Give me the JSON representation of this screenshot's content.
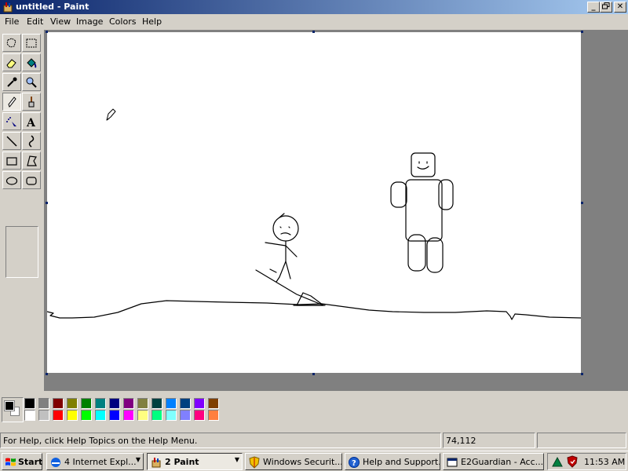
{
  "window": {
    "title": "untitled - Paint"
  },
  "menu": {
    "items": [
      "File",
      "Edit",
      "View",
      "Image",
      "Colors",
      "Help"
    ]
  },
  "tools": [
    "free-select",
    "rect-select",
    "eraser",
    "fill",
    "color-picker",
    "magnifier",
    "pencil",
    "brush",
    "airbrush",
    "text",
    "line",
    "curve",
    "rectangle",
    "polygon",
    "ellipse",
    "rounded-rectangle"
  ],
  "active_tool": "pencil",
  "palette": {
    "foreground": "#000000",
    "background": "#ffffff",
    "row1": [
      "#000000",
      "#808080",
      "#800000",
      "#808000",
      "#008000",
      "#008080",
      "#000080",
      "#800080",
      "#808040",
      "#004040",
      "#0080ff",
      "#004080",
      "#8000ff",
      "#804000"
    ],
    "row2": [
      "#ffffff",
      "#c0c0c0",
      "#ff0000",
      "#ffff00",
      "#00ff00",
      "#00ffff",
      "#0000ff",
      "#ff00ff",
      "#ffff80",
      "#00ff80",
      "#80ffff",
      "#8080ff",
      "#ff0080",
      "#ff8040"
    ]
  },
  "status": {
    "help_text": "For Help, click Help Topics on the Help Menu.",
    "coordinates": "74,112"
  },
  "taskbar": {
    "start_label": "Start",
    "tasks": [
      {
        "label": "4 Internet Expl...",
        "icon": "internet-explorer-icon",
        "active": false,
        "has_arrow": true
      },
      {
        "label": "2 Paint",
        "icon": "paint-icon",
        "active": true,
        "has_arrow": true
      },
      {
        "label": "Windows Securit...",
        "icon": "shield-icon",
        "active": false,
        "has_arrow": false
      },
      {
        "label": "Help and Support...",
        "icon": "help-icon",
        "active": false,
        "has_arrow": false
      },
      {
        "label": "E2Guardian - Acc...",
        "icon": "window-icon",
        "active": false,
        "has_arrow": false
      }
    ],
    "clock": "11:53 AM"
  }
}
